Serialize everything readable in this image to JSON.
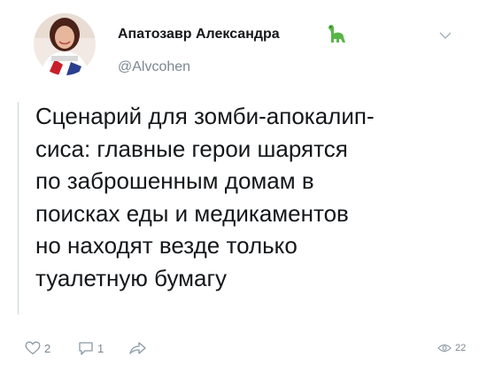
{
  "tweet": {
    "author": {
      "display_name": "Апатозавр Александра",
      "handle": "@Alvcohen",
      "badge_icon": "dinosaur-icon"
    },
    "text_lines": [
      "Сценарий для зомби-апокалип-",
      "сиса: главные герои шарятся",
      "по заброшенным домам в",
      "поисках еды и медикаментов",
      "но находят везде только",
      "туалетную бумагу"
    ],
    "stats": {
      "likes": "2",
      "replies": "1",
      "views": "22"
    }
  },
  "colors": {
    "text": "#14171a",
    "muted": "#7a8791",
    "dino": "#59b546"
  }
}
